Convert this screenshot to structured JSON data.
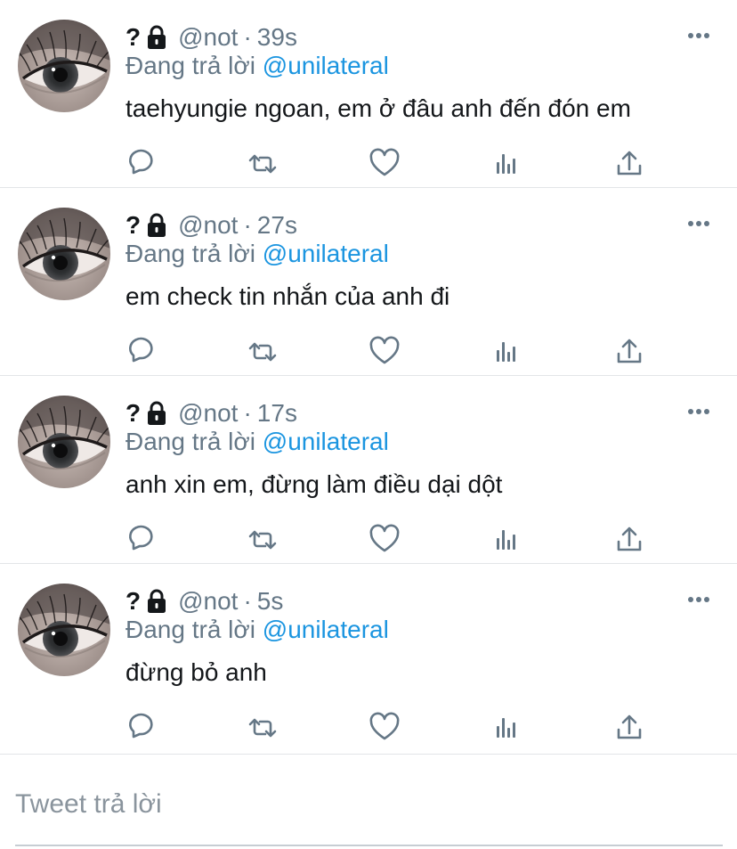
{
  "tweets": [
    {
      "name": "?",
      "handle": "@not",
      "separator": "·",
      "time": "39s",
      "reply_prefix": "Đang trả lời",
      "reply_to": "@unilateral",
      "text": "taehyungie ngoan, em ở đâu anh đến đón em"
    },
    {
      "name": "?",
      "handle": "@not",
      "separator": "·",
      "time": "27s",
      "reply_prefix": "Đang trả lời",
      "reply_to": "@unilateral",
      "text": "em check tin nhắn của anh đi"
    },
    {
      "name": "?",
      "handle": "@not",
      "separator": "·",
      "time": "17s",
      "reply_prefix": "Đang trả lời",
      "reply_to": "@unilateral",
      "text": "anh xin em, đừng làm điều dại dột"
    },
    {
      "name": "?",
      "handle": "@not",
      "separator": "·",
      "time": "5s",
      "reply_prefix": "Đang trả lời",
      "reply_to": "@unilateral",
      "text": "đừng bỏ anh"
    }
  ],
  "icons": {
    "lock": "lock-icon",
    "more": "more-options-icon",
    "reply": "reply-icon",
    "retweet": "retweet-icon",
    "like": "heart-icon",
    "analytics": "analytics-icon",
    "share": "share-icon"
  },
  "colors": {
    "text": "#14171a",
    "secondary": "#657786",
    "mention": "#1b95e0",
    "icon": "#657786",
    "divider": "#e3e5e8"
  },
  "reply_box": {
    "placeholder": "Tweet trả lời"
  }
}
